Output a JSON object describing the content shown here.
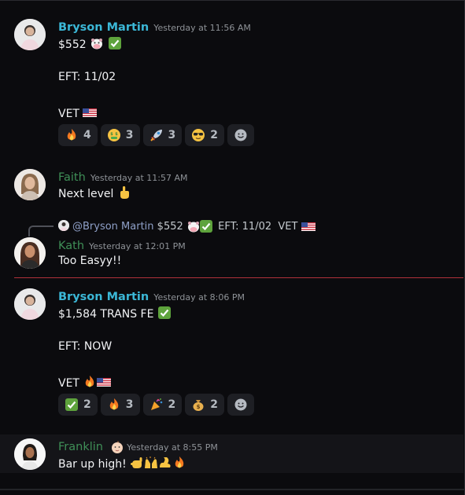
{
  "messages": [
    {
      "author": "Bryson Martin",
      "timestamp": "Yesterday at 11:56 AM",
      "lines": [
        "$552",
        "EFT: 11/02",
        "VET"
      ],
      "reactions": [
        {
          "emoji": "fire-emoji",
          "count": "4"
        },
        {
          "emoji": "money-mouth-emoji",
          "count": "3"
        },
        {
          "emoji": "rocket-emoji",
          "count": "3"
        },
        {
          "emoji": "sunglasses-emoji",
          "count": "2"
        }
      ]
    },
    {
      "author": "Faith",
      "timestamp": "Yesterday at 11:57 AM",
      "lines": [
        "Next level"
      ]
    },
    {
      "author": "Kath",
      "timestamp": "Yesterday at 12:01 PM",
      "reply": {
        "mention": "@Bryson Martin",
        "text1": "$552",
        "text2": "EFT: 11/02",
        "text3": "VET"
      },
      "lines": [
        "Too Easyy!!"
      ]
    },
    {
      "author": "Bryson Martin",
      "timestamp": "Yesterday at 8:06 PM",
      "lines": [
        "$1,584 TRANS FE",
        "EFT: NOW",
        "VET"
      ],
      "reactions": [
        {
          "emoji": "check-emoji",
          "count": "2"
        },
        {
          "emoji": "fire-emoji",
          "count": "3"
        },
        {
          "emoji": "party-popper-emoji",
          "count": "2"
        },
        {
          "emoji": "money-bag-emoji",
          "count": "2"
        }
      ]
    },
    {
      "author": "Franklin",
      "timestamp": "Yesterday at 8:55 PM",
      "lines": [
        "Bar up high!"
      ]
    }
  ],
  "colors": {
    "bryson": "#3bb7d6",
    "green_names": "#3f8f57",
    "new_divider": "#b0323a"
  }
}
